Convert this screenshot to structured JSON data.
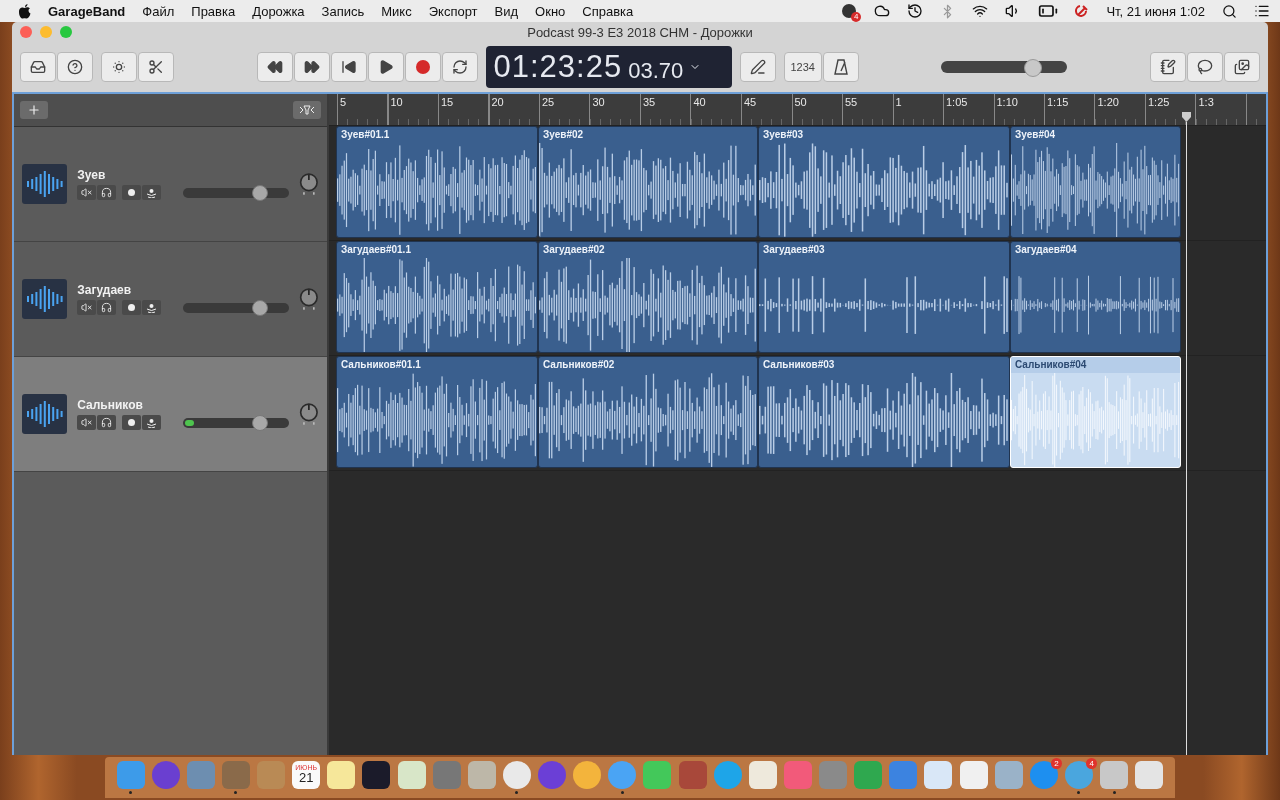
{
  "menu_bar": {
    "app": "GarageBand",
    "menus": [
      "Файл",
      "Правка",
      "Дорожка",
      "Запись",
      "Микс",
      "Экспорт",
      "Вид",
      "Окно",
      "Справка"
    ],
    "notification_badge": "4",
    "clock": "Чт, 21 июня 1:02"
  },
  "window": {
    "title": "Podcast 99-3 E3 2018 CHM - Дорожки"
  },
  "toolbar": {
    "record_active": true,
    "lcd_main": "01:23:25",
    "lcd_fraction": "03.70",
    "count_in": "1234",
    "master_volume": {
      "level": 0.73
    }
  },
  "ruler": {
    "labels": [
      "5",
      "10",
      "15",
      "20",
      "25",
      "30",
      "35",
      "40",
      "45",
      "50",
      "55",
      "1",
      "1:05",
      "1:10",
      "1:15",
      "1:20",
      "1:25",
      "1:3"
    ]
  },
  "tracks": [
    {
      "name": "Зуев",
      "selected": false,
      "volume": {
        "level": 0.72
      },
      "regions": [
        {
          "name": "Зуев#01.1",
          "selected": false
        },
        {
          "name": "Зуев#02",
          "selected": false
        },
        {
          "name": "Зуев#03",
          "selected": false
        },
        {
          "name": "Зуев#04",
          "selected": false
        }
      ]
    },
    {
      "name": "Загудаев",
      "selected": false,
      "volume": {
        "level": 0.72
      },
      "regions": [
        {
          "name": "Загудаев#01.1",
          "selected": false
        },
        {
          "name": "Загудаев#02",
          "selected": false
        },
        {
          "name": "Загудаев#03",
          "selected": false
        },
        {
          "name": "Загудаев#04",
          "selected": false
        }
      ]
    },
    {
      "name": "Сальников",
      "selected": true,
      "volume": {
        "level": 0.72
      },
      "meter": {
        "level": 0.08
      },
      "regions": [
        {
          "name": "Сальников#01.1",
          "selected": false
        },
        {
          "name": "Сальников#02",
          "selected": false
        },
        {
          "name": "Сальников#03",
          "selected": false
        },
        {
          "name": "Сальников#04",
          "selected": true
        }
      ]
    }
  ],
  "dock": {
    "items": [
      {
        "running": true
      },
      {
        "running": false
      },
      {
        "running": false
      },
      {
        "running": true
      },
      {
        "running": false
      },
      {
        "running": false,
        "month": "ИЮНЬ",
        "day": "21"
      },
      {
        "running": false
      },
      {
        "running": false
      },
      {
        "running": false
      },
      {
        "running": false
      },
      {
        "running": false
      },
      {
        "running": true
      },
      {
        "running": false
      },
      {
        "running": false
      },
      {
        "running": true
      },
      {
        "running": false
      },
      {
        "running": false
      },
      {
        "running": false
      },
      {
        "running": false
      },
      {
        "running": false
      },
      {
        "running": false
      },
      {
        "running": false
      },
      {
        "running": false
      },
      {
        "running": false
      },
      {
        "running": false
      },
      {
        "running": false
      },
      {
        "running": false,
        "badge": "2"
      },
      {
        "running": true,
        "badge": "4"
      },
      {
        "running": true
      },
      {
        "running": false
      }
    ]
  }
}
